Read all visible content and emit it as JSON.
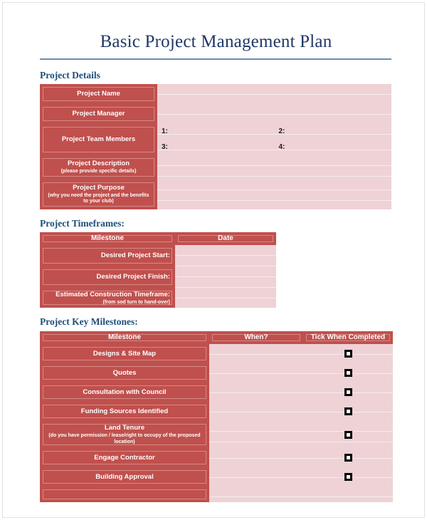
{
  "document": {
    "title": "Basic Project Management Plan"
  },
  "sections": {
    "details": {
      "heading": "Project Details",
      "rows": [
        {
          "label": "Project Name",
          "sub": ""
        },
        {
          "label": "Project Manager",
          "sub": ""
        },
        {
          "label": "Project Team Members",
          "sub": ""
        },
        {
          "label": "Project Description",
          "sub": "(please provide specific details)"
        },
        {
          "label": "Project Purpose",
          "sub": "(why you need the project and the benefits to your club)"
        }
      ],
      "team_members": [
        {
          "number": "1:",
          "value": ""
        },
        {
          "number": "2:",
          "value": ""
        },
        {
          "number": "3:",
          "value": ""
        },
        {
          "number": "4:",
          "value": ""
        }
      ]
    },
    "timeframes": {
      "heading": "Project Timeframes:",
      "columns": [
        "Milestone",
        "Date"
      ],
      "rows": [
        {
          "label": "Desired Project Start:",
          "sub": "",
          "date": ""
        },
        {
          "label": "Desired Project Finish:",
          "sub": "",
          "date": ""
        },
        {
          "label": "Estimated Construction Timeframe:",
          "sub": "(from sod turn to hand-over)",
          "date": ""
        }
      ]
    },
    "milestones": {
      "heading": "Project Key Milestones:",
      "columns": [
        "Milestone",
        "When?",
        "Tick When Completed"
      ],
      "rows": [
        {
          "label": "Designs & Site Map",
          "sub": "",
          "when": "",
          "tick": "checkbox-icon"
        },
        {
          "label": "Quotes",
          "sub": "",
          "when": "",
          "tick": "checkbox-icon"
        },
        {
          "label": "Consultation with Council",
          "sub": "",
          "when": "",
          "tick": "checkbox-icon"
        },
        {
          "label": "Funding Sources Identified",
          "sub": "",
          "when": "",
          "tick": "checkbox-icon"
        },
        {
          "label": "Land Tenure",
          "sub": "(do you have permission / lease/right to occupy of the proposed location)",
          "when": "",
          "tick": "checkbox-icon"
        },
        {
          "label": "Engage Contractor",
          "sub": "",
          "when": "",
          "tick": "checkbox-icon"
        },
        {
          "label": "Building Approval",
          "sub": "",
          "when": "",
          "tick": "checkbox-icon"
        }
      ]
    }
  },
  "colors": {
    "accent_red": "#c0504d",
    "fill_pink": "#eed2d6",
    "heading_blue": "#1f4e79",
    "title_navy": "#1f3864",
    "rule_blue": "#6f8cb0"
  }
}
